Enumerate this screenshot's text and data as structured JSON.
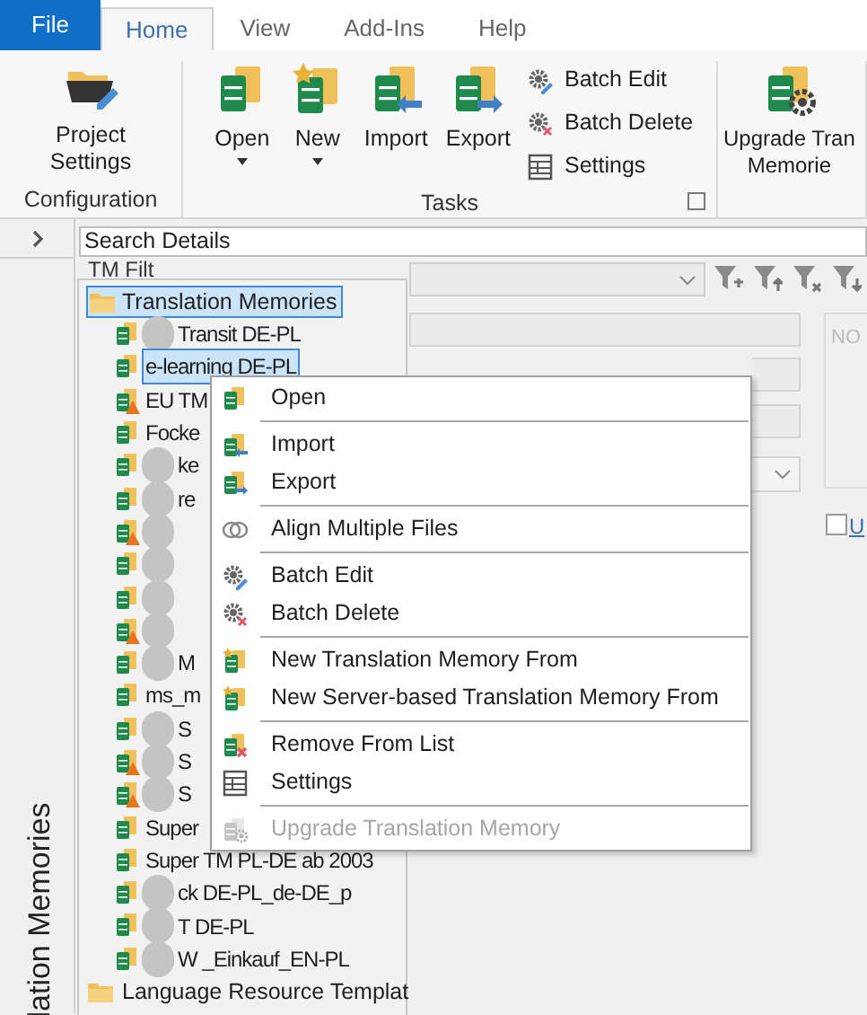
{
  "tabs": [
    {
      "label": "File",
      "kind": "file",
      "selected": false
    },
    {
      "label": "Home",
      "kind": "tab",
      "selected": true
    },
    {
      "label": "View",
      "kind": "tab",
      "selected": false
    },
    {
      "label": "Add-Ins",
      "kind": "tab",
      "selected": false
    },
    {
      "label": "Help",
      "kind": "tab",
      "selected": false
    }
  ],
  "ribbon_groups": [
    {
      "label": "Configuration",
      "buttons": [
        {
          "label": "Project Settings",
          "kind": "project",
          "dropdown": false
        }
      ]
    },
    {
      "label": "Tasks",
      "buttons": [
        {
          "label": "Open",
          "kind": "open",
          "dropdown": true
        },
        {
          "label": "New",
          "kind": "new",
          "dropdown": true
        },
        {
          "label": "Import",
          "kind": "import",
          "dropdown": false
        },
        {
          "label": "Export",
          "kind": "export",
          "dropdown": false
        }
      ],
      "small_buttons": [
        {
          "label": "Batch Edit",
          "kind": "gear-edit"
        },
        {
          "label": "Batch Delete",
          "kind": "gear-delete"
        },
        {
          "label": "Settings",
          "kind": "settings"
        }
      ],
      "launcher": true
    },
    {
      "label_lines": [
        "Upgrade Tran",
        "Memorie"
      ],
      "kind": "upgrade"
    }
  ],
  "side_strip": {
    "title": "lation Memories"
  },
  "search_details": {
    "title": "Search Details"
  },
  "tm_filter": {
    "label": "TM Filt"
  },
  "right_panel": {
    "header": "NO",
    "checkbox_label": "U",
    "checked": false
  },
  "tree": {
    "root": {
      "label": "Translation Memories",
      "selected": true,
      "children": [
        {
          "label": "Transit DE-PL",
          "warning": false,
          "blurred": true,
          "selected": false
        },
        {
          "label": "e-learning DE-PL",
          "warning": false,
          "blurred": false,
          "selected": true
        },
        {
          "label": "EU TM",
          "warning": true,
          "blurred": false,
          "selected": false
        },
        {
          "label": "Focke",
          "warning": false,
          "blurred": false,
          "selected": false
        },
        {
          "label": "ke",
          "warning": false,
          "blurred": true,
          "selected": false
        },
        {
          "label": "re",
          "warning": false,
          "blurred": true,
          "selected": false
        },
        {
          "warning": true,
          "blurred": true,
          "selected": false
        },
        {
          "warning": false,
          "blurred": true,
          "selected": false
        },
        {
          "warning": false,
          "blurred": true,
          "selected": false
        },
        {
          "warning": true,
          "blurred": true,
          "selected": false
        },
        {
          "label": "M",
          "warning": false,
          "blurred": true,
          "selected": false
        },
        {
          "label": "ms_m",
          "warning": false,
          "blurred": false,
          "selected": false
        },
        {
          "label": "S",
          "warning": false,
          "blurred": true,
          "selected": false
        },
        {
          "label": "S",
          "warning": true,
          "blurred": true,
          "selected": false
        },
        {
          "label": "S",
          "warning": true,
          "blurred": true,
          "selected": false
        },
        {
          "label": "Super",
          "warning": false,
          "blurred": false,
          "selected": false
        },
        {
          "label": "Super TM PL-DE ab 2003",
          "warning": false,
          "blurred": false,
          "selected": false
        },
        {
          "label": "ck DE-PL_de-DE_p",
          "warning": false,
          "blurred": true,
          "selected": false
        },
        {
          "label": "T DE-PL",
          "warning": false,
          "blurred": true,
          "selected": false
        },
        {
          "label": "W _Einkauf_EN-PL",
          "warning": false,
          "blurred": true,
          "selected": false
        }
      ]
    },
    "second": {
      "label": "Language Resource Templat",
      "selected": false
    }
  },
  "context_menu": {
    "groups": [
      [
        {
          "label": "Open",
          "kind": "open",
          "disabled": false
        }
      ],
      [
        {
          "label": "Import",
          "kind": "import",
          "disabled": false
        },
        {
          "label": "Export",
          "kind": "export",
          "disabled": false
        }
      ],
      [
        {
          "label": "Align Multiple Files",
          "kind": "align",
          "disabled": false
        }
      ],
      [
        {
          "label": "Batch Edit",
          "kind": "gear-edit",
          "disabled": false
        },
        {
          "label": "Batch Delete",
          "kind": "gear-delete",
          "disabled": false
        }
      ],
      [
        {
          "label": "New Translation Memory From",
          "kind": "new",
          "disabled": false
        },
        {
          "label": "New Server-based Translation Memory From",
          "kind": "new",
          "disabled": false
        }
      ],
      [
        {
          "label": "Remove From List",
          "kind": "remove",
          "disabled": false
        },
        {
          "label": "Settings",
          "kind": "settings",
          "disabled": false
        }
      ],
      [
        {
          "label": "Upgrade Translation Memory",
          "kind": "upgrade",
          "disabled": true
        }
      ]
    ]
  }
}
